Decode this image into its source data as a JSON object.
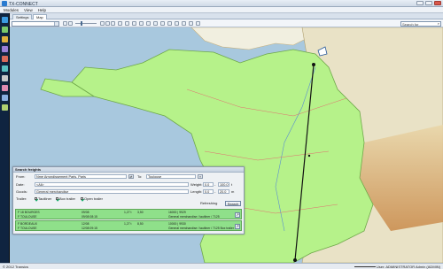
{
  "app": {
    "title": "TX-CONNECT"
  },
  "menu": [
    "Modules",
    "View",
    "Help"
  ],
  "tabs": [
    {
      "label": "Settings",
      "active": false
    },
    {
      "label": "Map",
      "active": true
    }
  ],
  "toolbar": {
    "search_placeholder": "Search for"
  },
  "search_panel": {
    "title": "Search freights",
    "from_label": "From:",
    "from_value": "Nme Arrondissement Paris, Paris",
    "to_label": "To:",
    "to_value": "Toulouse",
    "date_label": "Date:",
    "date_value": "<All>",
    "goods_label": "Goods:",
    "goods_value": "General merchandise",
    "weight_label": "Weight:",
    "weight_from": "0.0",
    "weight_to": "100.0",
    "weight_unit": "t",
    "length_label": "Length:",
    "length_from": "0.0",
    "length_to": "20.0",
    "length_unit": "m",
    "trailer_label": "Trailer:",
    "trailer_options": [
      {
        "label": "Tautliner",
        "checked": true
      },
      {
        "label": "Box trailer",
        "checked": true
      },
      {
        "label": "Open trailer",
        "checked": true
      }
    ],
    "refresh_label": "Refreshing",
    "search_button": "Search",
    "results": [
      {
        "from": "F 18 BOURGES",
        "to": "F TOULOUSE",
        "date1": "09/08",
        "date2": "09/08 08:15",
        "weight": "1,27 t",
        "length": "3,50",
        "ref": "16000 | 9929",
        "goods": "General merchandise / tautliner / 7125"
      },
      {
        "from": "F BORDEAUX",
        "to": "F TOULOUSE",
        "date1": "12/08",
        "date2": "12/08 09:15",
        "weight": "1,27 t",
        "length": "8,50",
        "ref": "10000 | 9930",
        "goods": "General merchandise / tautliner / 7125 Box trailer"
      }
    ]
  },
  "status": {
    "left": "© 2012 Transics",
    "right": "User: ADMINISTRATOR Admin (ADMIN)"
  },
  "colors": {
    "sea": "#a8c8de",
    "highlight": "#b6f28a",
    "route": "#111111",
    "result_row": "#8fe08a"
  }
}
